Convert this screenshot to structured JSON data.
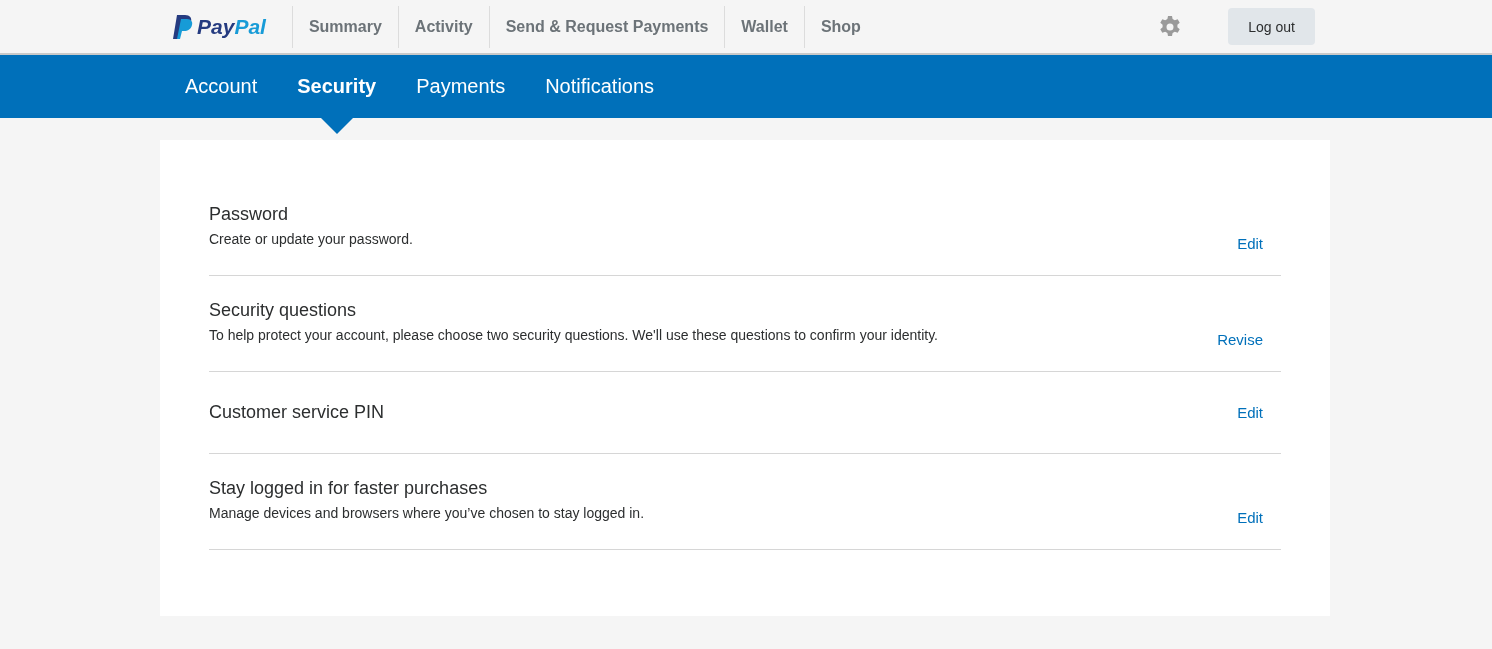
{
  "logo": "PayPal",
  "nav": [
    "Summary",
    "Activity",
    "Send & Request Payments",
    "Wallet",
    "Shop"
  ],
  "logout": "Log out",
  "tabs": [
    {
      "label": "Account",
      "selected": false
    },
    {
      "label": "Security",
      "selected": true
    },
    {
      "label": "Payments",
      "selected": false
    },
    {
      "label": "Notifications",
      "selected": false
    }
  ],
  "settings": [
    {
      "title": "Password",
      "description": "Create or update your password.",
      "action": "Edit"
    },
    {
      "title": "Security questions",
      "description": "To help protect your account, please choose two security questions. We'll use these questions to confirm your identity.",
      "action": "Revise"
    },
    {
      "title": "Customer service PIN",
      "action": "Edit"
    },
    {
      "title": "Stay logged in for faster purchases",
      "description": "Manage devices and browsers where you’ve chosen to stay logged in.",
      "action": "Edit"
    }
  ]
}
